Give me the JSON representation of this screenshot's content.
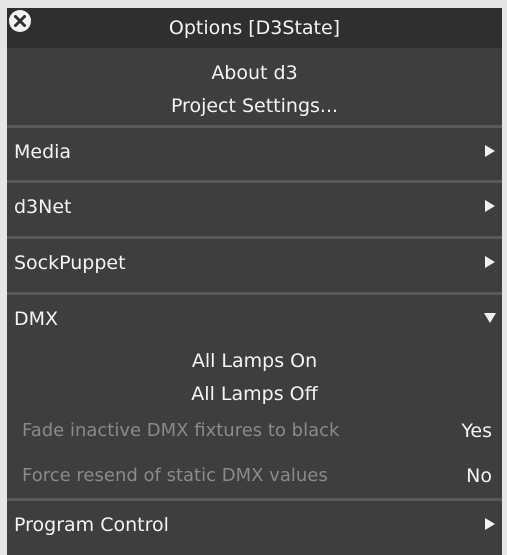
{
  "window": {
    "title": "Options [D3State]"
  },
  "top_items": [
    {
      "label": "About d3"
    },
    {
      "label": "Project Settings..."
    }
  ],
  "sections": {
    "media": {
      "label": "Media",
      "state": "collapsed"
    },
    "d3net": {
      "label": "d3Net",
      "state": "collapsed"
    },
    "sockpuppet": {
      "label": "SockPuppet",
      "state": "collapsed"
    },
    "dmx": {
      "label": "DMX",
      "state": "expanded",
      "actions": [
        {
          "label": "All Lamps On"
        },
        {
          "label": "All Lamps Off"
        }
      ],
      "options": [
        {
          "label": "Fade inactive DMX fixtures to black",
          "value": "Yes"
        },
        {
          "label": "Force resend of static DMX values",
          "value": "No"
        }
      ]
    },
    "program_control": {
      "label": "Program Control",
      "state": "collapsed"
    }
  },
  "icons": {
    "close": "close-icon",
    "collapsed_arrow": "triangle-right-icon",
    "expanded_arrow": "triangle-down-icon"
  },
  "colors": {
    "panel_bg": "#3e3e3e",
    "titlebar_bg": "#2f2f2f",
    "divider": "#5a5a5a",
    "text": "#f4f4f4",
    "disabled_text": "#8a8a8a"
  }
}
